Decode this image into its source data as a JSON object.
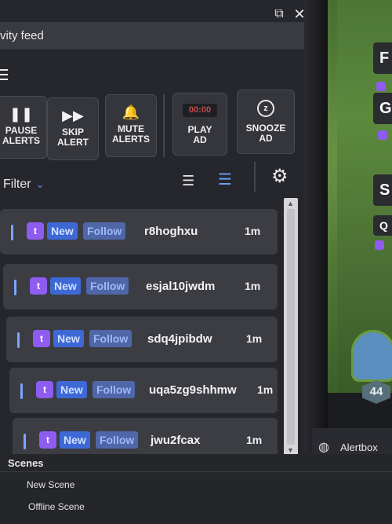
{
  "window": {
    "title": "vity feed",
    "popout_glyph": "⧉",
    "close_glyph": "✕"
  },
  "toolbar": {
    "pause_label_1": "PAUSE",
    "pause_label_2": "ALERTS",
    "skip_label_1": "SKIP",
    "skip_label_2": "ALERT",
    "mute_label_1": "MUTE",
    "mute_label_2": "ALERTS",
    "ad_timer": "00:00",
    "play_ad_label_1": "PLAY",
    "play_ad_label_2": "AD",
    "snooze_label_1": "SNOOZE",
    "snooze_label_2": "AD",
    "icons": {
      "pause": "❚❚",
      "skip": "▶▶",
      "mute": "🔔",
      "snooze": "z"
    }
  },
  "filter": {
    "label": "Filter",
    "chevron": "⌄"
  },
  "view_icons": {
    "list": "☰",
    "compact": "☰",
    "settings": "⚙"
  },
  "feed": {
    "items": [
      {
        "platform_glyph": "t",
        "new_label": "New",
        "type_label": "Follow",
        "username": "r8hoghxu",
        "time": "1m"
      },
      {
        "platform_glyph": "t",
        "new_label": "New",
        "type_label": "Follow",
        "username": "esjal10jwdm",
        "time": "1m"
      },
      {
        "platform_glyph": "t",
        "new_label": "New",
        "type_label": "Follow",
        "username": "sdq4jpibdw",
        "time": "1m"
      },
      {
        "platform_glyph": "t",
        "new_label": "New",
        "type_label": "Follow",
        "username": "uqa5zg9shhmw",
        "time": "1m"
      },
      {
        "platform_glyph": "t",
        "new_label": "New",
        "type_label": "Follow",
        "username": "jwu2fcax",
        "time": "1m"
      }
    ]
  },
  "scenes": {
    "header": "Scenes",
    "items": [
      "New Scene",
      "Offline Scene"
    ]
  },
  "sources": {
    "alertbox_label": "Alertbox",
    "alertbox_icon": "◍"
  },
  "preview": {
    "card_letters": [
      "F",
      "G",
      "S",
      "Q"
    ],
    "level": "44"
  },
  "colors": {
    "accent": "#5b8ff5",
    "twitch": "#8e5cf0",
    "new_badge": "#3e68d6",
    "follow_badge": "#4f67a8"
  }
}
